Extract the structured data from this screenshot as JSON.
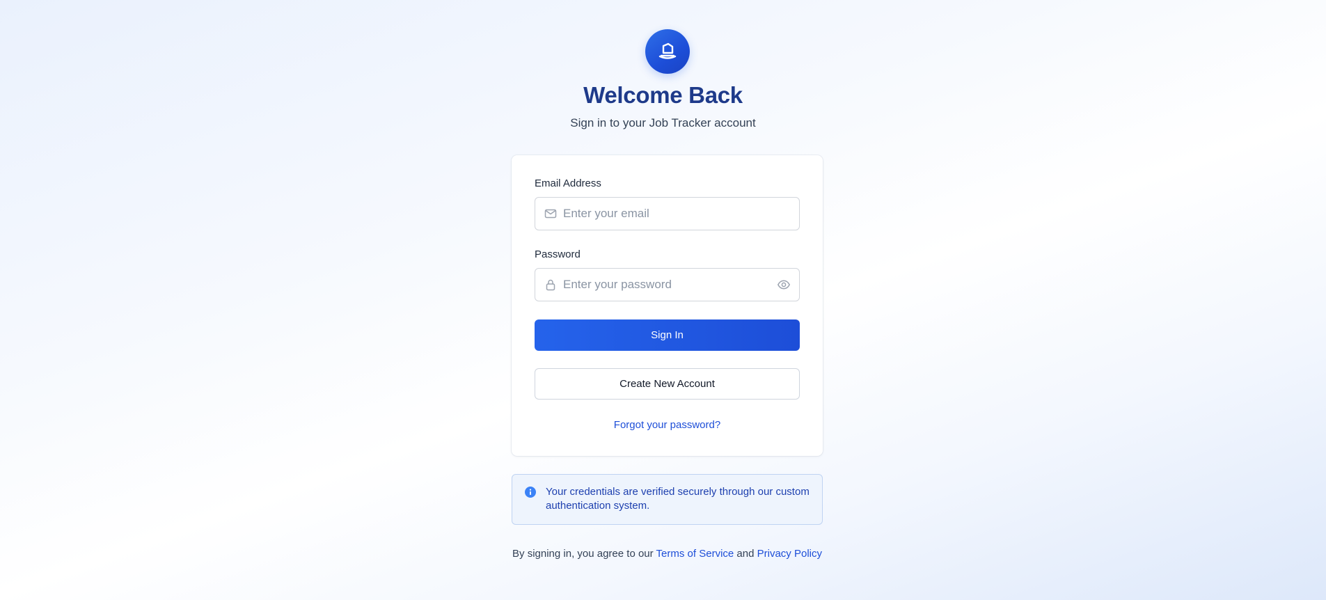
{
  "header": {
    "logo_icon": "briefcase-icon",
    "title": "Welcome Back",
    "subtitle": "Sign in to your Job Tracker account"
  },
  "form": {
    "email_label": "Email Address",
    "email_placeholder": "Enter your email",
    "email_value": "",
    "email_icon": "mail-icon",
    "password_label": "Password",
    "password_placeholder": "Enter your password",
    "password_value": "",
    "password_icon": "lock-icon",
    "show_password_icon": "eye-icon",
    "sign_in_label": "Sign In",
    "create_account_label": "Create New Account",
    "forgot_password_label": "Forgot your password?"
  },
  "info_notice": {
    "icon": "info-icon",
    "text": "Your credentials are verified securely through our custom authentication system."
  },
  "legal": {
    "prefix": "By signing in, you agree to our ",
    "terms_label": "Terms of Service",
    "conjunction": " and ",
    "privacy_label": "Privacy Policy"
  },
  "colors": {
    "primary": "#2563eb",
    "title": "#1e3a8a",
    "link": "#1d4ed8",
    "info_bg": "#eef4fd"
  }
}
